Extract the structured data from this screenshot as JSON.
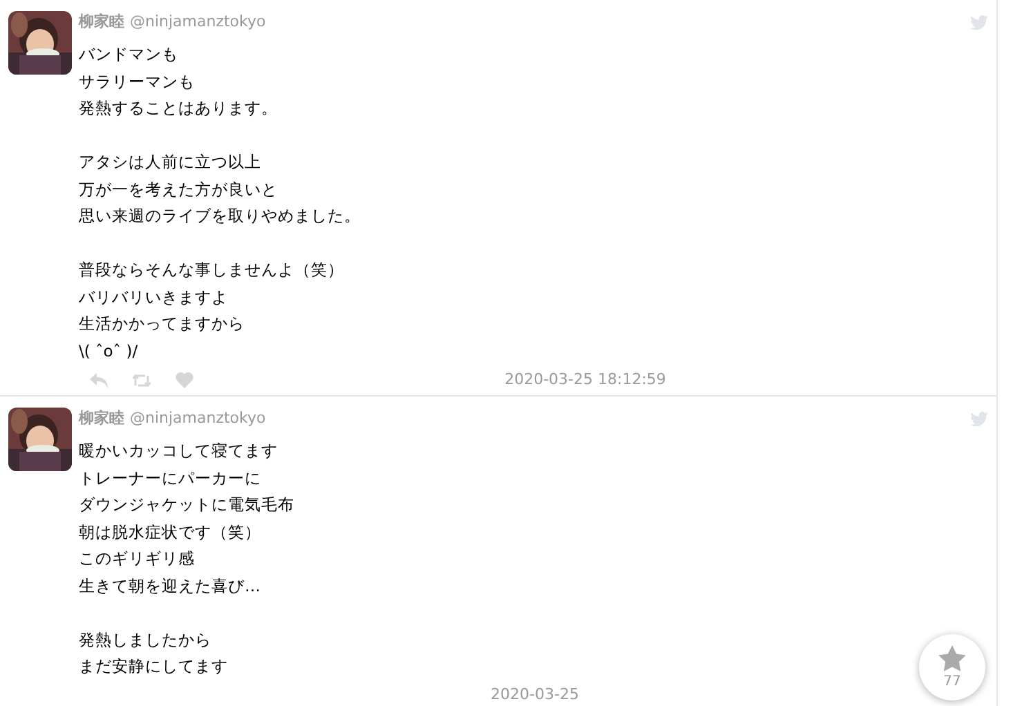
{
  "tweets": [
    {
      "name": "柳家睦",
      "handle": "@ninjamanztokyo",
      "paragraphs": [
        [
          "バンドマンも",
          "サラリーマンも",
          "発熱することはあります。"
        ],
        [
          "アタシは人前に立つ以上",
          "万が一を考えた方が良いと",
          "思い来週のライブを取りやめました。"
        ],
        [
          "普段ならそんな事しませんよ（笑）",
          "バリバリいきますよ",
          "生活かかってますから",
          "\\( ˆoˆ )/"
        ]
      ],
      "show_actions": true,
      "time": "2020-03-25 18:12:59"
    },
    {
      "name": "柳家睦",
      "handle": "@ninjamanztokyo",
      "paragraphs": [
        [
          "暖かいカッコして寝てます",
          "トレーナーにパーカーに",
          "ダウンジャケットに電気毛布",
          "朝は脱水症状です（笑）",
          "このギリギリ感",
          "生きて朝を迎えた喜び…"
        ],
        [
          "発熱しましたから",
          "まだ安静にしてます"
        ]
      ],
      "show_actions": false,
      "time": "2020-03-25"
    }
  ],
  "favorite_button": {
    "count": "77"
  }
}
